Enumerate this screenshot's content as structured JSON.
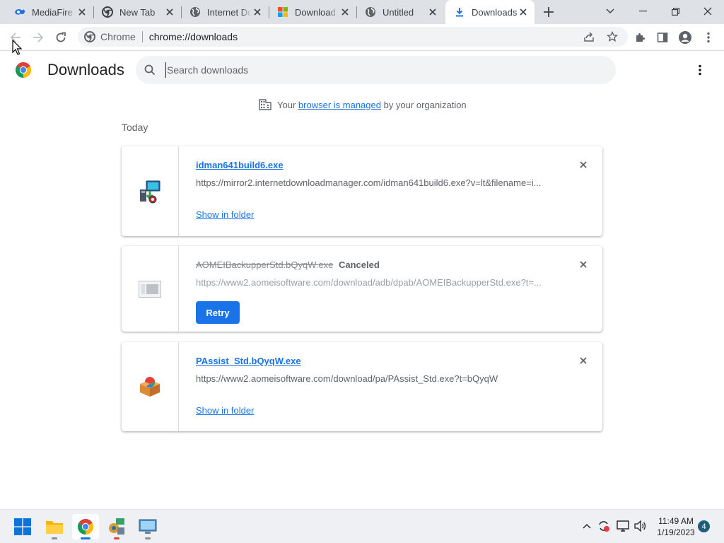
{
  "window": {
    "tabs": [
      {
        "label": "MediaFire -",
        "icon": "mediafire-icon"
      },
      {
        "label": "New Tab",
        "icon": "chrome-icon"
      },
      {
        "label": "Internet Do",
        "icon": "globe-icon"
      },
      {
        "label": "Download",
        "icon": "windows-logo-icon"
      },
      {
        "label": "Untitled",
        "icon": "globe-icon"
      },
      {
        "label": "Downloads",
        "icon": "download-icon",
        "active": true
      }
    ]
  },
  "omnibox": {
    "chip_label": "Chrome",
    "url": "chrome://downloads"
  },
  "page": {
    "title": "Downloads",
    "search_placeholder": "Search downloads",
    "managed_prefix": "Your",
    "managed_link": "browser is managed",
    "managed_suffix": "by your organization",
    "date_header": "Today"
  },
  "downloads": [
    {
      "filename": "idman641build6.exe",
      "url": "https://mirror2.internetdownloadmanager.com/idman641build6.exe?v=lt&filename=i...",
      "action": "Show in folder",
      "status": "completed"
    },
    {
      "filename": "AOMEIBackupperStd.bQyqW.exe",
      "status_label": "Canceled",
      "url": "https://www2.aomeisoftware.com/download/adb/dpab/AOMEIBackupperStd.exe?t=...",
      "action": "Retry",
      "status": "canceled"
    },
    {
      "filename": "PAssist_Std.bQyqW.exe",
      "url": "https://www2.aomeisoftware.com/download/pa/PAssist_Std.exe?t=bQyqW",
      "action": "Show in folder",
      "status": "completed"
    }
  ],
  "taskbar": {
    "time": "11:49 AM",
    "date": "1/19/2023",
    "notification_count": "4",
    "accent_color": "#1a73e8"
  }
}
